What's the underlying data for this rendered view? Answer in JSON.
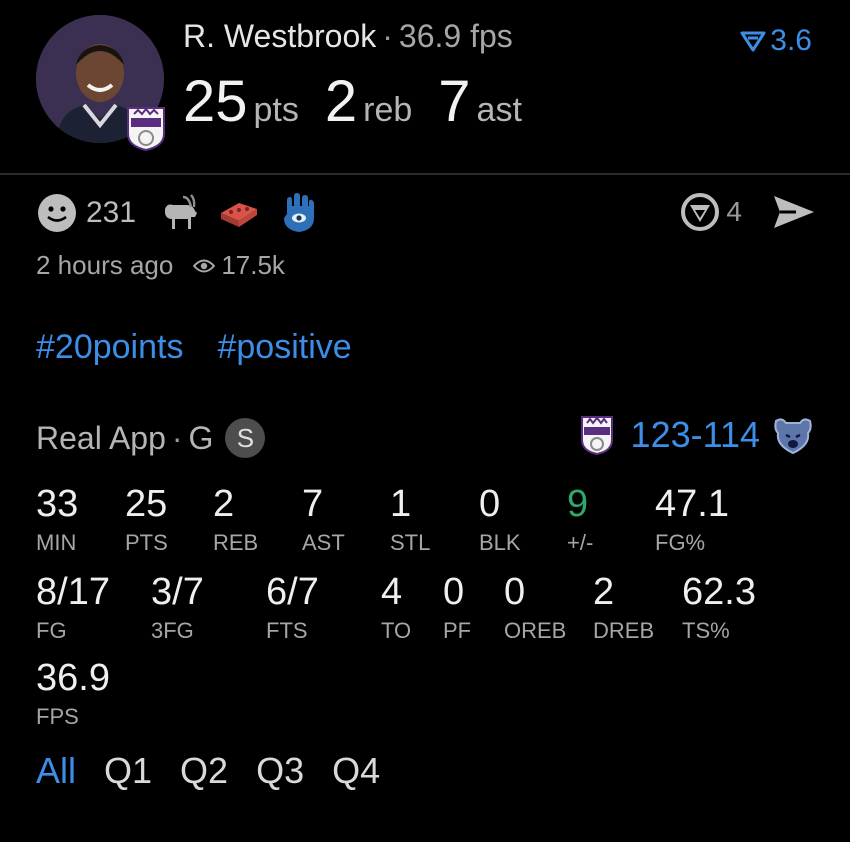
{
  "player": {
    "name": "R. Westbrook",
    "fps_text": "36.9 fps",
    "pts": "25",
    "pts_unit": "pts",
    "reb": "2",
    "reb_unit": "reb",
    "ast": "7",
    "ast_unit": "ast",
    "score": "3.6"
  },
  "reactions": {
    "count": "231",
    "comments": "4",
    "icons": [
      "smiley-icon",
      "goat-icon",
      "brick-icon",
      "hamsa-icon"
    ]
  },
  "meta": {
    "time": "2 hours ago",
    "views": "17.5k"
  },
  "tags": [
    "#20points",
    "#positive"
  ],
  "source": {
    "app": "Real App",
    "position": "G",
    "badge": "S",
    "score": "123-114"
  },
  "stats": {
    "row1": [
      {
        "v": "33",
        "l": "MIN"
      },
      {
        "v": "25",
        "l": "PTS"
      },
      {
        "v": "2",
        "l": "REB"
      },
      {
        "v": "7",
        "l": "AST"
      },
      {
        "v": "1",
        "l": "STL"
      },
      {
        "v": "0",
        "l": "BLK"
      },
      {
        "v": "9",
        "l": "+/-"
      },
      {
        "v": "47.1",
        "l": "FG%"
      }
    ],
    "row2": [
      {
        "v": "8/17",
        "l": "FG"
      },
      {
        "v": "3/7",
        "l": "3FG"
      },
      {
        "v": "6/7",
        "l": "FTS"
      },
      {
        "v": "4",
        "l": "TO"
      },
      {
        "v": "0",
        "l": "PF"
      },
      {
        "v": "0",
        "l": "OREB"
      },
      {
        "v": "2",
        "l": "DREB"
      },
      {
        "v": "62.3",
        "l": "TS%"
      }
    ],
    "row3": [
      {
        "v": "36.9",
        "l": "FPS"
      }
    ]
  },
  "periods": [
    "All",
    "Q1",
    "Q2",
    "Q3",
    "Q4"
  ],
  "colors": {
    "accent": "#3d8ee6",
    "positive": "#2ea86b",
    "background": "#000000"
  }
}
